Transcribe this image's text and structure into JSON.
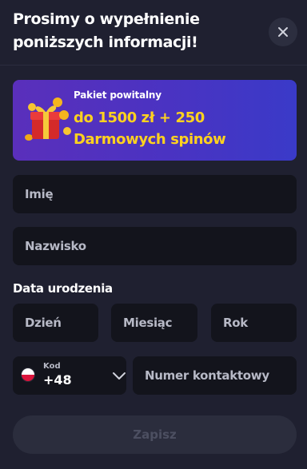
{
  "header": {
    "title": "Prosimy o wypełnienie poniższych informacji!"
  },
  "banner": {
    "subtitle": "Pakiet powitalny",
    "headline": "do 1500 zł + 250 Darmowych spinów",
    "icon": "gift-coins-icon"
  },
  "form": {
    "first_name_placeholder": "Imię",
    "last_name_placeholder": "Nazwisko",
    "dob_label": "Data urodzenia",
    "day_placeholder": "Dzień",
    "month_placeholder": "Miesiąc",
    "year_placeholder": "Rok",
    "phone": {
      "code_label": "Kod",
      "code_value": "+48",
      "country_flag": "poland-flag-icon",
      "number_placeholder": "Numer kontaktowy"
    },
    "submit_label": "Zapisz"
  },
  "colors": {
    "background": "#1f2030",
    "field_background": "#13141c",
    "banner_gradient_start": "#5a2fbb",
    "banner_gradient_end": "#3a3ac8",
    "accent_yellow": "#ffd21f",
    "submit_disabled_bg": "#2b2d3d",
    "submit_disabled_text": "#4c4f61"
  }
}
